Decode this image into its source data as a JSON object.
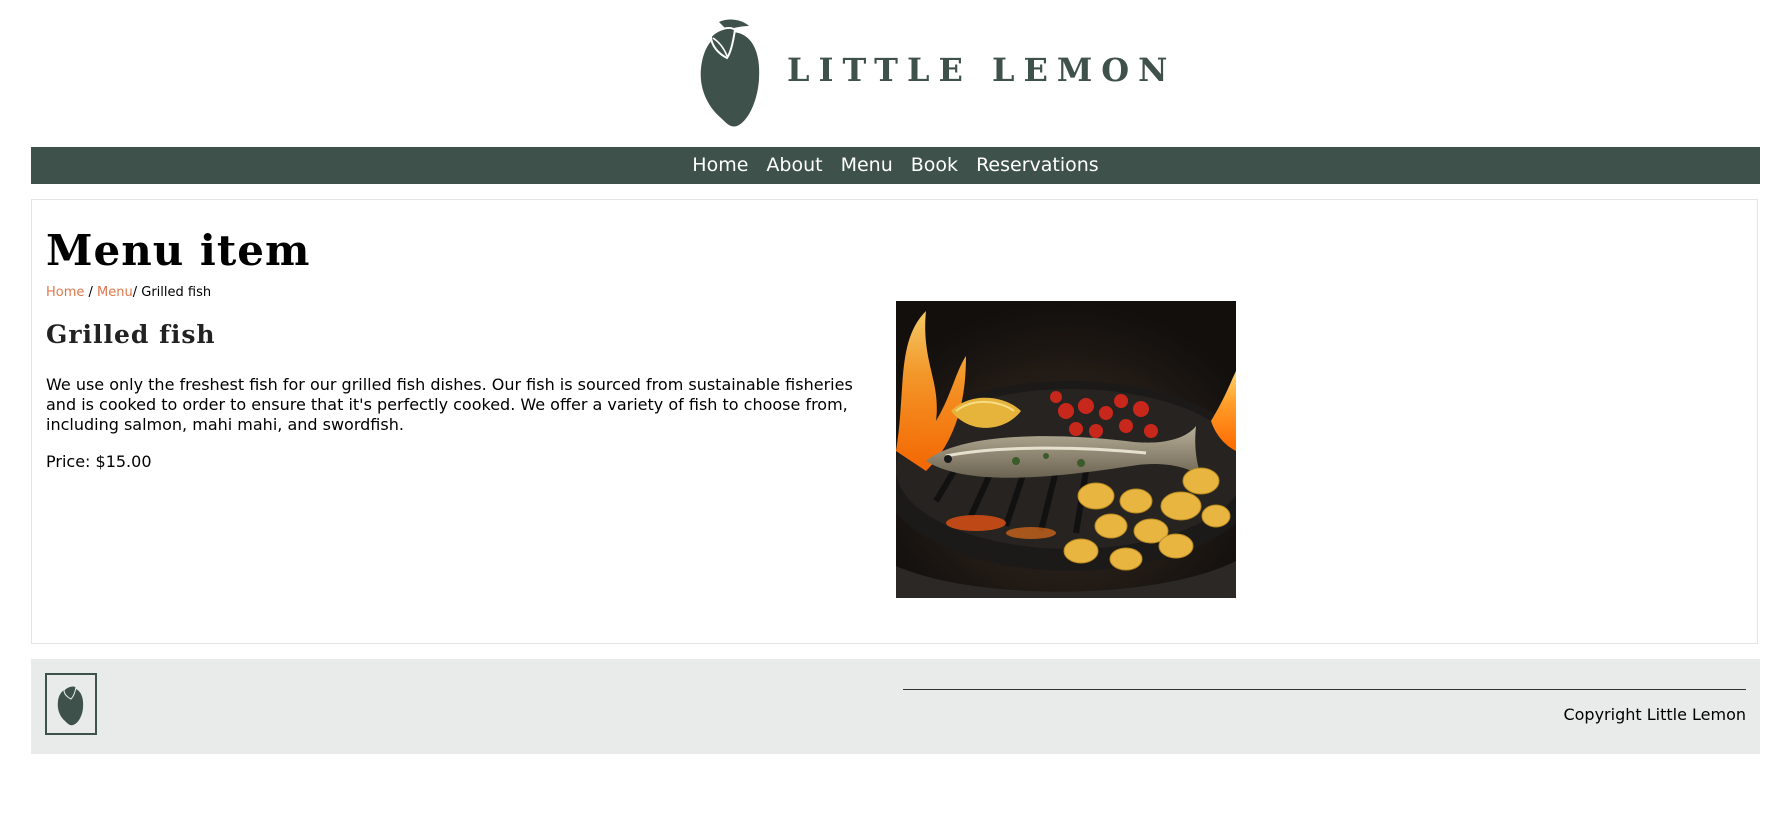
{
  "header": {
    "logo_icon": "lemon-icon",
    "brand_name": "LITTLE LEMON"
  },
  "nav": {
    "items": [
      "Home",
      "About",
      "Menu",
      "Book",
      "Reservations"
    ]
  },
  "main": {
    "page_title": "Menu item",
    "breadcrumb": {
      "home": "Home",
      "separator1": " / ",
      "menu": "Menu",
      "current": "/ Grilled fish"
    },
    "item": {
      "name": "Grilled fish",
      "description": "We use only the freshest fish for our grilled fish dishes. Our fish is sourced from sustainable fisheries and is cooked to order to ensure that it's perfectly cooked. We offer a variety of fish to choose from, including salmon, mahi mahi, and swordfish.",
      "price": "Price: $15.00",
      "photo_icon": "grilled-fish-photo"
    }
  },
  "footer": {
    "logo_icon": "lemon-icon",
    "copyright": "Copyright Little Lemon"
  },
  "colors": {
    "brand_green": "#3f514b",
    "link_orange": "#e0784c",
    "footer_bg": "#e9ebea"
  }
}
